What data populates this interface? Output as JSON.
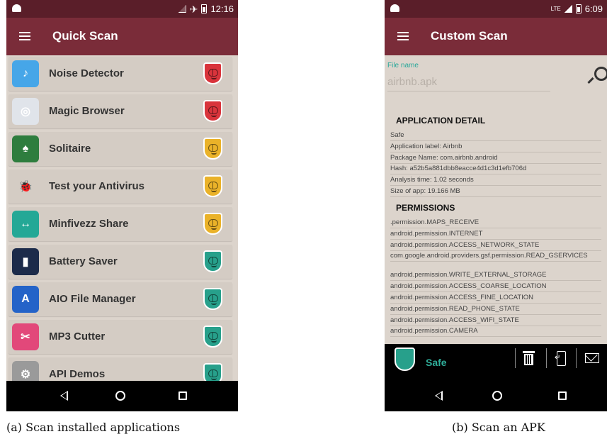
{
  "quick_scan": {
    "status_time": "12:16",
    "title": "Quick Scan",
    "apps": [
      {
        "name": "Noise Detector",
        "risk": "#d9343c",
        "icon_color": "#46a6e8",
        "icon_glyph": "♪"
      },
      {
        "name": "Magic Browser",
        "risk": "#d9343c",
        "icon_color": "#e0e4ea",
        "icon_glyph": "◎"
      },
      {
        "name": "Solitaire",
        "risk": "#eab229",
        "icon_color": "#2e7d3e",
        "icon_glyph": "♠"
      },
      {
        "name": "Test your Antivirus",
        "risk": "#eab229",
        "icon_color": "#d4ccc4",
        "icon_glyph": "🐞"
      },
      {
        "name": "Minfivezz Share",
        "risk": "#eab229",
        "icon_color": "#24a896",
        "icon_glyph": "↔"
      },
      {
        "name": "Battery Saver",
        "risk": "#27a08b",
        "icon_color": "#1c2b4a",
        "icon_glyph": "▮"
      },
      {
        "name": "AIO File Manager",
        "risk": "#27a08b",
        "icon_color": "#2463c8",
        "icon_glyph": "A"
      },
      {
        "name": "MP3 Cutter",
        "risk": "#27a08b",
        "icon_color": "#e2487a",
        "icon_glyph": "✂"
      },
      {
        "name": "API Demos",
        "risk": "#27a08b",
        "icon_color": "#9a9a9a",
        "icon_glyph": "⚙"
      }
    ]
  },
  "custom_scan": {
    "status_time": "6:09",
    "status_network": "LTE",
    "title": "Custom Scan",
    "file_label": "File name",
    "file_value": "airbnb.apk",
    "application_detail_heading": "APPLICATION DETAIL",
    "details": [
      "Safe",
      "Application label: Airbnb",
      "Package Name: com.airbnb.android",
      "Hash: a52b5a881dbb8eacce4d1c3d1efb706d",
      "Analysis time: 1.02 seconds",
      "Size of app: 19.166 MB"
    ],
    "permissions_heading": "PERMISSIONS",
    "permissions": [
      ".permission.MAPS_RECEIVE",
      "android.permission.INTERNET",
      "android.permission.ACCESS_NETWORK_STATE",
      "com.google.android.providers.gsf.permission.READ_GSERVICES",
      "android.permission.WRITE_EXTERNAL_STORAGE",
      "android.permission.ACCESS_COARSE_LOCATION",
      "android.permission.ACCESS_FINE_LOCATION",
      "android.permission.READ_PHONE_STATE",
      "android.permission.ACCESS_WIFI_STATE",
      "android.permission.CAMERA"
    ],
    "result_label": "Safe",
    "result_color": "#27a08b"
  },
  "captions": {
    "a": "(a) Scan installed applications",
    "b": "(b) Scan an APK"
  }
}
